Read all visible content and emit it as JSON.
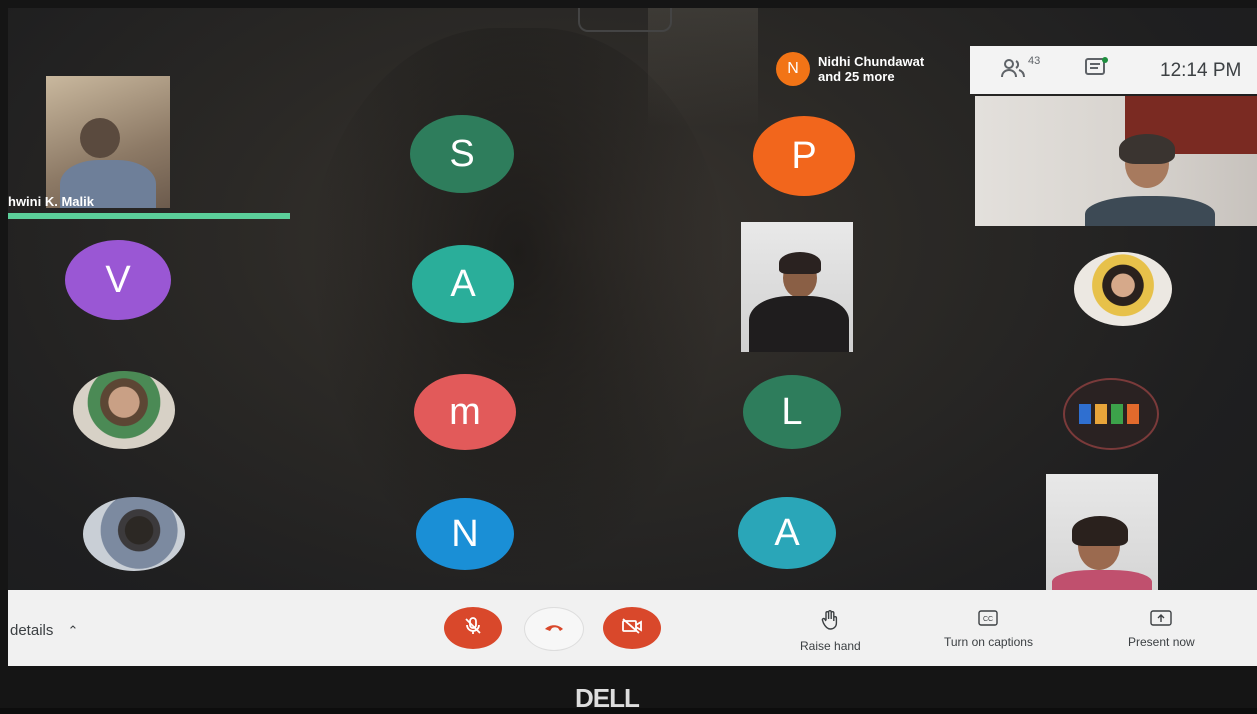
{
  "presenter": {
    "name": "hwini K. Malik"
  },
  "participants_popup": {
    "initial": "N",
    "line1": "Nidhi Chundawat",
    "line2": "and 25 more"
  },
  "topbar": {
    "people_icon": "people-icon",
    "people_count": "43",
    "chat_icon": "chat-icon",
    "time": "12:14 PM"
  },
  "grid": {
    "col1": [
      "V"
    ],
    "col2": [
      "S",
      "A",
      "m",
      "N"
    ],
    "col3": [
      "P",
      "L",
      "A"
    ]
  },
  "avatar_colors": {
    "S": "#2e7d5c",
    "A1": "#2aae9a",
    "m": "#e25a5a",
    "N": "#1a8fd6",
    "P": "#f2661c",
    "L": "#2e7d5c",
    "A2": "#2aa6b8",
    "V": "#9a57d4"
  },
  "controls": {
    "details_label": "details",
    "mic_icon": "mic-off-icon",
    "hangup_icon": "hangup-icon",
    "camera_icon": "camera-off-icon",
    "raise_hand_label": "Raise hand",
    "captions_label": "Turn on captions",
    "present_label": "Present now"
  },
  "bezel_logo": "DELL",
  "accent": {
    "red": "#d9482b",
    "speaking": "#5bcf9a",
    "orange": "#f27416"
  }
}
